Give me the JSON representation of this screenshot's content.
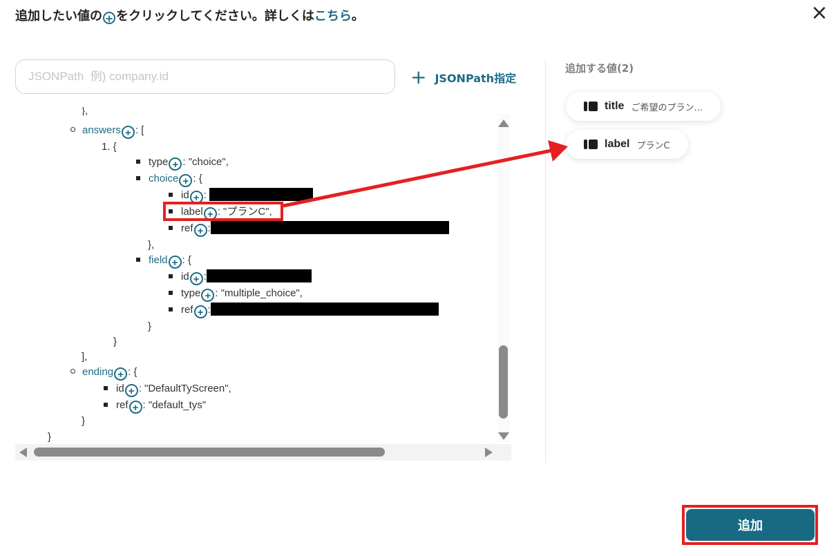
{
  "header": {
    "text_before": "追加したい値の",
    "plus_glyph": "+",
    "text_after": "をクリックしてください。詳しくは",
    "link": "こちら",
    "end": "。"
  },
  "close_glyph": "×",
  "search": {
    "placeholder": "JSONPath  例) company.id",
    "value": ""
  },
  "jsonpath_button": {
    "icon": "+",
    "label": "JSONPath指定"
  },
  "tree": {
    "plus_glyph": "+",
    "top_partial": "},",
    "answers": {
      "key": "answers",
      "open": ": ["
    },
    "item_index": "1. {",
    "type_line": {
      "key": "type",
      "value": ": \"choice\","
    },
    "choice": {
      "key": "choice",
      "open": ": {"
    },
    "choice_id": {
      "key": "id",
      "sep": ":"
    },
    "choice_label": {
      "key": "label",
      "value": ": \"プランC\","
    },
    "choice_ref": {
      "key": "ref",
      "sep": ":"
    },
    "choice_close": "},",
    "field": {
      "key": "field",
      "open": ": {"
    },
    "field_id": {
      "key": "id",
      "sep": ":"
    },
    "field_type": {
      "key": "type",
      "value": ": \"multiple_choice\","
    },
    "field_ref": {
      "key": "ref",
      "sep": ":"
    },
    "field_close": "}",
    "item_close": "}",
    "answers_close": "],",
    "ending": {
      "key": "ending",
      "open": ": {"
    },
    "ending_id": {
      "key": "id",
      "value": ": \"DefaultTyScreen\","
    },
    "ending_ref": {
      "key": "ref",
      "value": ": \"default_tys\""
    },
    "ending_close": "}",
    "root_close": "}"
  },
  "side_panel": {
    "title": "追加する値(2)",
    "chips": [
      {
        "name": "title",
        "value": "ご希望のプラン..."
      },
      {
        "name": "label",
        "value": "プランC"
      }
    ]
  },
  "add_button": {
    "label": "追加"
  },
  "colors": {
    "accent": "#1e6b84",
    "button": "#176a82",
    "highlight": "#e42020"
  }
}
